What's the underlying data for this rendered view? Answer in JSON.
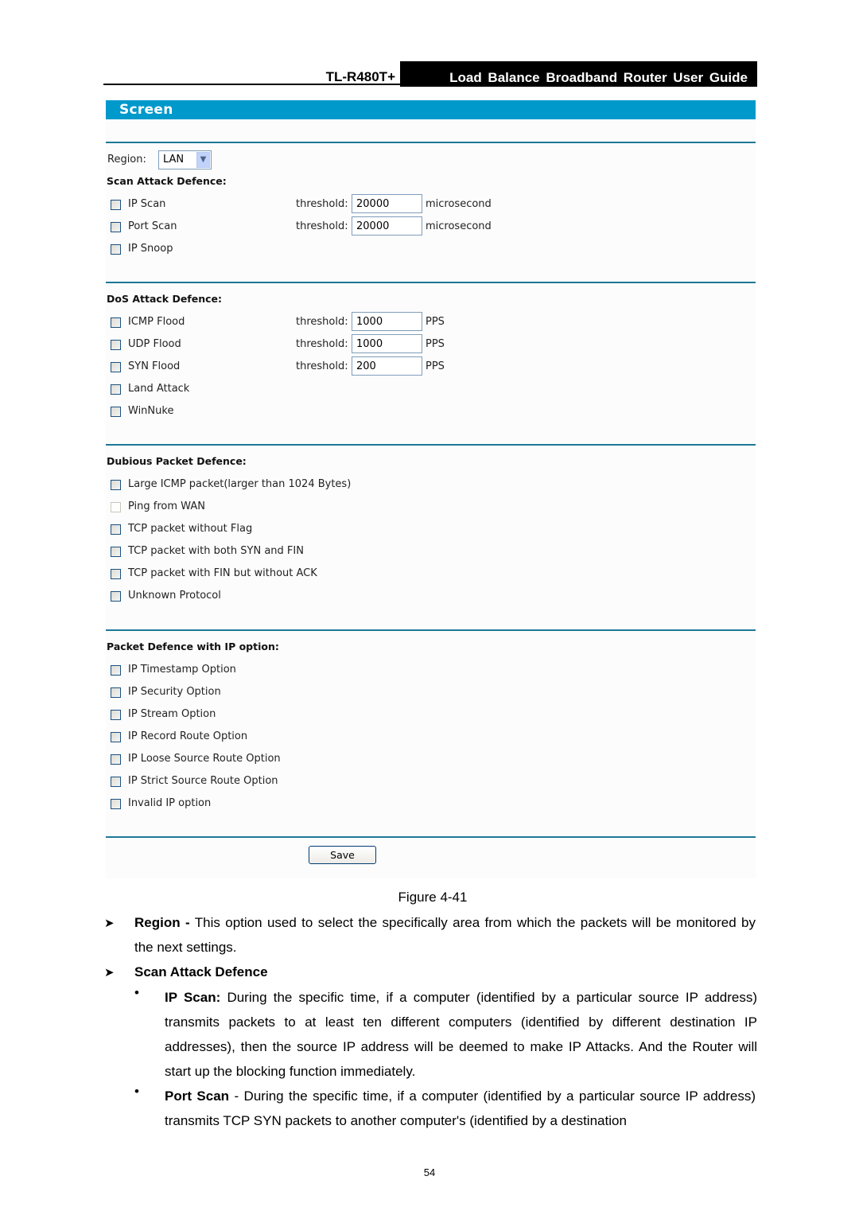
{
  "header": {
    "model": "TL-R480T+",
    "guide_title": "Load Balance Broadband Router User Guide"
  },
  "screen": {
    "title": "Screen",
    "region": {
      "label": "Region:",
      "value": "LAN"
    },
    "sections": {
      "scan": {
        "title": "Scan Attack Defence:",
        "items": [
          {
            "label": "IP Scan",
            "checked": false,
            "threshold_label": "threshold:",
            "threshold": "20000",
            "unit": "microsecond"
          },
          {
            "label": "Port Scan",
            "checked": false,
            "threshold_label": "threshold:",
            "threshold": "20000",
            "unit": "microsecond"
          },
          {
            "label": "IP Snoop",
            "checked": false
          }
        ]
      },
      "dos": {
        "title": "DoS Attack Defence:",
        "items": [
          {
            "label": "ICMP Flood",
            "checked": false,
            "threshold_label": "threshold:",
            "threshold": "1000",
            "unit": "PPS"
          },
          {
            "label": "UDP Flood",
            "checked": false,
            "threshold_label": "threshold:",
            "threshold": "1000",
            "unit": "PPS"
          },
          {
            "label": "SYN Flood",
            "checked": false,
            "threshold_label": "threshold:",
            "threshold": "200",
            "unit": "PPS"
          },
          {
            "label": "Land Attack",
            "checked": false
          },
          {
            "label": "WinNuke",
            "checked": false
          }
        ]
      },
      "dubious": {
        "title": "Dubious Packet Defence:",
        "items": [
          {
            "label": "Large ICMP packet(larger than 1024 Bytes)",
            "checked": false
          },
          {
            "label": "Ping from WAN",
            "checked": false,
            "disabled": true
          },
          {
            "label": "TCP packet without Flag",
            "checked": false
          },
          {
            "label": "TCP packet with both SYN and FIN",
            "checked": false
          },
          {
            "label": "TCP packet with FIN but without ACK",
            "checked": false
          },
          {
            "label": "Unknown Protocol",
            "checked": false
          }
        ]
      },
      "ipoption": {
        "title": "Packet Defence with IP option:",
        "items": [
          {
            "label": "IP Timestamp Option",
            "checked": false
          },
          {
            "label": "IP Security Option",
            "checked": false
          },
          {
            "label": "IP Stream Option",
            "checked": false
          },
          {
            "label": "IP Record Route Option",
            "checked": false
          },
          {
            "label": "IP Loose Source Route Option",
            "checked": false
          },
          {
            "label": "IP Strict Source Route Option",
            "checked": false
          },
          {
            "label": "Invalid IP option",
            "checked": false
          }
        ]
      }
    },
    "save_label": "Save"
  },
  "figure_caption": "Figure 4-41",
  "body": {
    "region_term": "Region -",
    "region_desc": " This option used to select the specifically area from which the packets will be monitored by the next settings.",
    "scan_heading": "Scan Attack Defence",
    "ip_scan_term": "IP Scan:",
    "ip_scan_desc": " During the specific time, if a computer (identified by a particular source IP address) transmits packets to at least ten different computers (identified by different destination IP addresses), then the source IP address will be deemed to make IP Attacks. And the Router will start up the blocking function immediately.",
    "port_scan_term": "Port Scan",
    "port_scan_desc": " - During the specific time, if a computer (identified by a particular source IP address) transmits TCP SYN packets to another computer's (identified by a destination"
  },
  "page_number": "54",
  "colors": {
    "title_bar": "#0099cc",
    "divider": "#1e7898",
    "panel_bg": "#fcfcfc"
  }
}
